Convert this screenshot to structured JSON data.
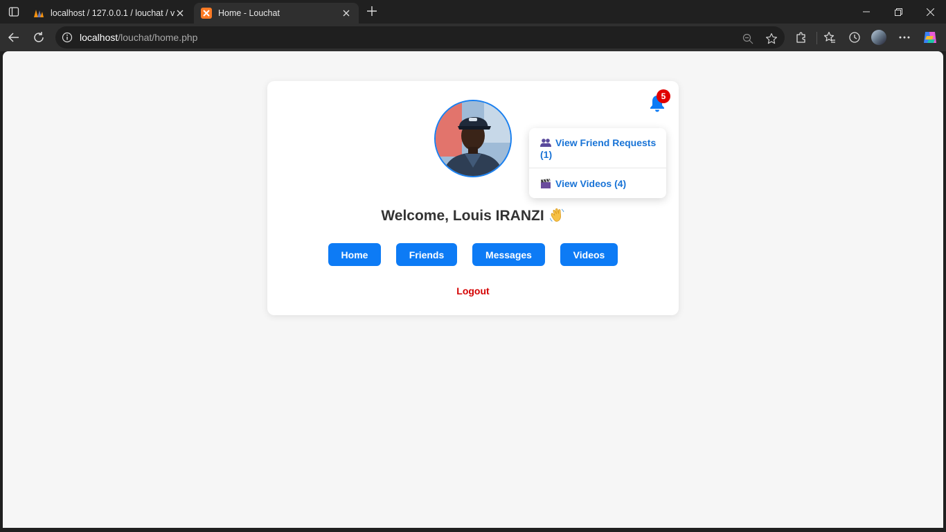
{
  "browser": {
    "tabs": [
      {
        "title": "localhost / 127.0.0.1 / louchat / vi",
        "active": false
      },
      {
        "title": "Home - Louchat",
        "active": true
      }
    ],
    "url_host": "localhost",
    "url_path": "/louchat/home.php"
  },
  "notifications": {
    "count": "5"
  },
  "dropdown": {
    "friend_requests": "View Friend Requests (1)",
    "videos": "View Videos (4)"
  },
  "welcome": "Welcome, Louis IRANZI",
  "nav": {
    "home": "Home",
    "friends": "Friends",
    "messages": "Messages",
    "videos": "Videos"
  },
  "logout": "Logout",
  "colors": {
    "accent": "#0d7bf5",
    "logout": "#d40000",
    "badge": "#e00000"
  },
  "icons": [
    "sidebar-toggle-icon",
    "phpmyadmin-favicon",
    "xampp-favicon",
    "close-icon",
    "plus-icon",
    "minimize-icon",
    "restore-icon",
    "window-close-icon",
    "back-icon",
    "reload-icon",
    "info-icon",
    "zoom-out-icon",
    "star-icon",
    "extensions-icon",
    "favorites-icon",
    "history-icon",
    "more-icon",
    "copilot-icon",
    "bell-icon",
    "people-icon",
    "clapper-icon",
    "wave-emoji"
  ]
}
